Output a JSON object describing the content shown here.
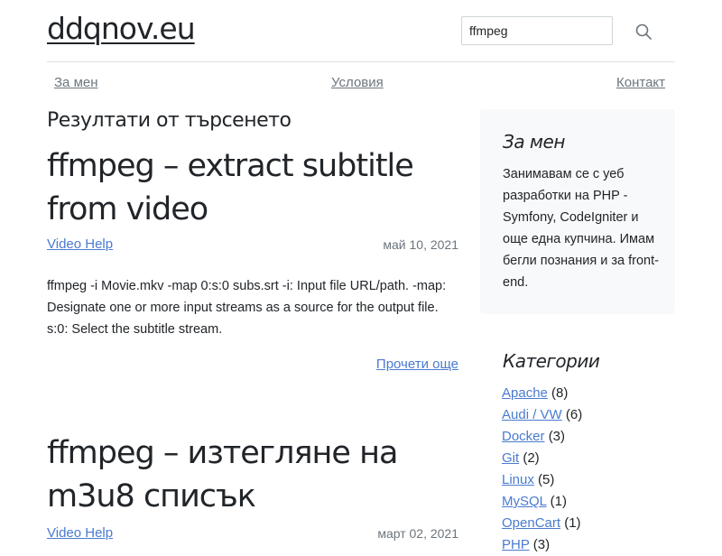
{
  "site": {
    "title": "ddqnov.eu"
  },
  "search": {
    "value": "ffmpeg",
    "icon": "search-icon"
  },
  "nav": {
    "items": [
      {
        "label": "За мен"
      },
      {
        "label": "Условия"
      },
      {
        "label": "Контакт"
      }
    ]
  },
  "results": {
    "heading": "Резултати от търсенето",
    "posts": [
      {
        "title": "ffmpeg – extract subtitle from video",
        "category": "Video Help",
        "date": "май 10, 2021",
        "excerpt": "ffmpeg -i Movie.mkv -map 0:s:0 subs.srt -i: Input file URL/path. -map: Designate one or more input streams as a source for the output file. s:0: Select the subtitle stream.",
        "read_more": "Прочети още"
      },
      {
        "title": "ffmpeg – изтегляне на m3u8 списък",
        "category": "Video Help",
        "date": "март 02, 2021"
      }
    ]
  },
  "sidebar": {
    "about": {
      "heading": "За мен",
      "text": "Занимавам се с уеб разработки на PHP - Symfony, CodeIgniter и още една купчина. Имам бегли познания и за front-end."
    },
    "categories": {
      "heading": "Категории",
      "items": [
        {
          "name": "Apache",
          "count": "(8)"
        },
        {
          "name": "Audi / VW",
          "count": "(6)"
        },
        {
          "name": "Docker",
          "count": "(3)"
        },
        {
          "name": "Git",
          "count": "(2)"
        },
        {
          "name": "Linux",
          "count": "(5)"
        },
        {
          "name": "MySQL",
          "count": "(1)"
        },
        {
          "name": "OpenCart",
          "count": "(1)"
        },
        {
          "name": "PHP",
          "count": "(3)"
        }
      ]
    }
  }
}
